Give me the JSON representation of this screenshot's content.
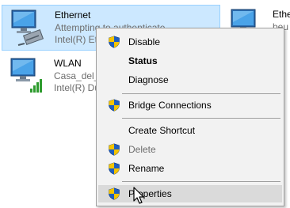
{
  "adapters": [
    {
      "name": "Ethernet",
      "status": "Attempting to authenticate",
      "device": "Intel(R) Et",
      "selected": true,
      "icon": "ethernet-adapter-icon"
    },
    {
      "name": "WLAN",
      "status": "Casa_del_",
      "device": "Intel(R) Du",
      "selected": false,
      "icon": "wlan-adapter-icon"
    },
    {
      "name": "Ethe",
      "status": "beu",
      "device": "Bl",
      "selected": false,
      "icon": "ethernet-adapter-icon"
    }
  ],
  "context_menu": {
    "items": [
      {
        "label": "Disable",
        "shield": true,
        "bold": false,
        "disabled": false
      },
      {
        "label": "Status",
        "shield": false,
        "bold": true,
        "disabled": false
      },
      {
        "label": "Diagnose",
        "shield": false,
        "bold": false,
        "disabled": false
      },
      {
        "label": "Bridge Connections",
        "shield": true,
        "bold": false,
        "disabled": false
      },
      {
        "label": "Create Shortcut",
        "shield": false,
        "bold": false,
        "disabled": false
      },
      {
        "label": "Delete",
        "shield": true,
        "bold": false,
        "disabled": true
      },
      {
        "label": "Rename",
        "shield": true,
        "bold": false,
        "disabled": false
      },
      {
        "label": "Properties",
        "shield": true,
        "bold": false,
        "disabled": false,
        "hovered": true
      }
    ]
  },
  "colors": {
    "selection_bg": "#cce8ff",
    "selection_border": "#99d1ff",
    "menu_bg": "#f2f2f2",
    "menu_hover": "#dadada",
    "shield_blue": "#1f5fbf",
    "shield_yellow": "#f5c400"
  }
}
